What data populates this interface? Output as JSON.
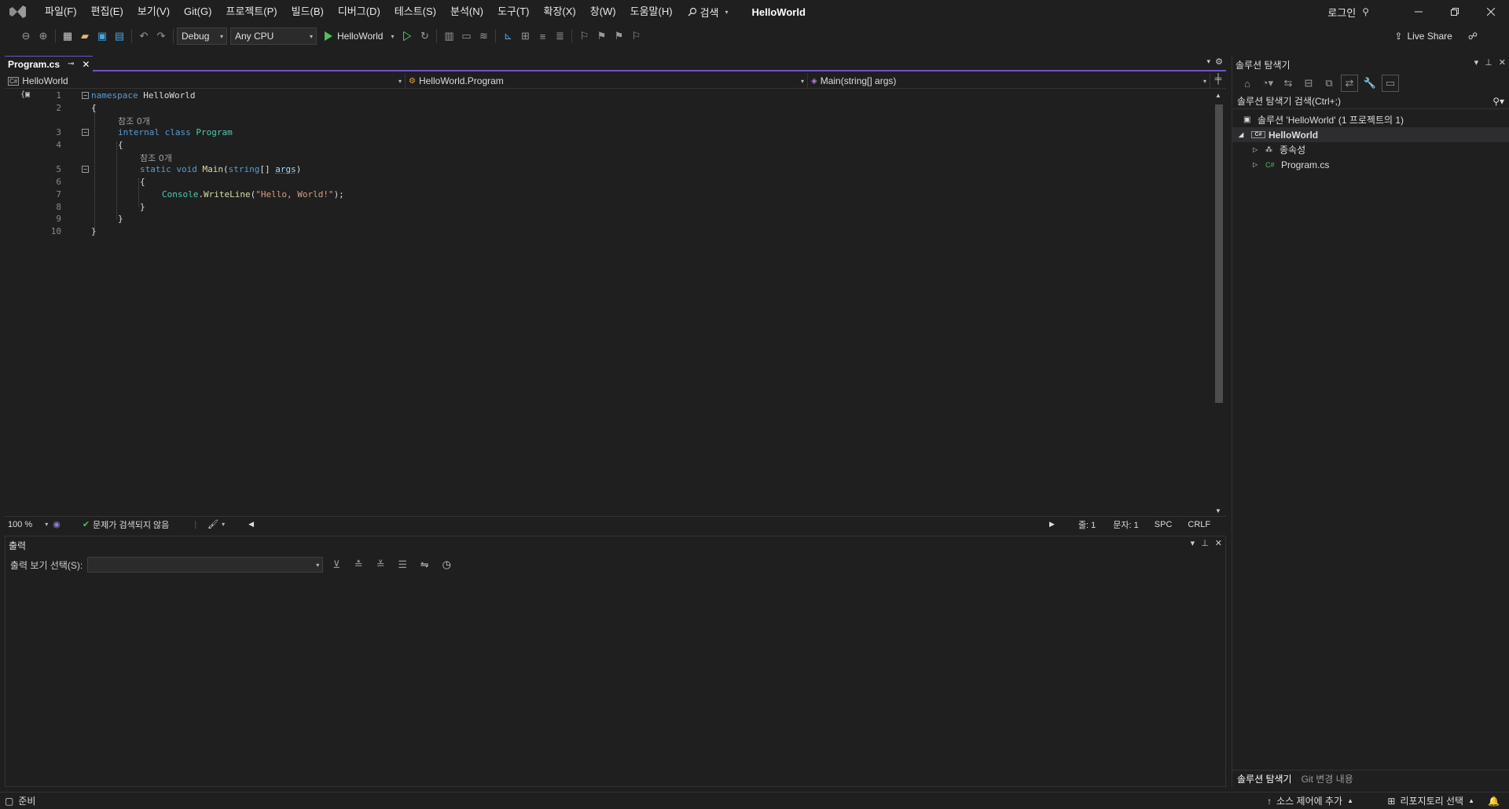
{
  "menu": {
    "items": [
      "파일(F)",
      "편집(E)",
      "보기(V)",
      "Git(G)",
      "프로젝트(P)",
      "빌드(B)",
      "디버그(D)",
      "테스트(S)",
      "분석(N)",
      "도구(T)",
      "확장(X)",
      "창(W)",
      "도움말(H)"
    ],
    "search_label": "검색",
    "solution_name": "HelloWorld",
    "login_label": "로그인"
  },
  "toolbar": {
    "config": "Debug",
    "platform": "Any CPU",
    "run_target": "HelloWorld",
    "live_share": "Live Share"
  },
  "editor": {
    "tab_label": "Program.cs",
    "nav_project": "HelloWorld",
    "nav_type": "HelloWorld.Program",
    "nav_member": "Main(string[] args)",
    "line_numbers": [
      "1",
      "2",
      "3",
      "4",
      "5",
      "6",
      "7",
      "8",
      "9",
      "10"
    ],
    "ref_count_1": "참조 0개",
    "ref_count_2": "참조 0개",
    "code": {
      "l1_kw": "namespace",
      "l1_name": " HelloWorld",
      "l2": "{",
      "l3_kw1": "internal",
      "l3_kw2": "class",
      "l3_type": "Program",
      "l4": "{",
      "l5_kw1": "static",
      "l5_kw2": "void",
      "l5_fn": "Main",
      "l5_p1": "(",
      "l5_kw3": "string",
      "l5_p2": "[] ",
      "l5_param": "args",
      "l5_p3": ")",
      "l6": "{",
      "l7_type": "Console",
      "l7_dot": ".",
      "l7_fn": "WriteLine",
      "l7_p1": "(",
      "l7_str": "\"Hello, World!\"",
      "l7_p2": ");",
      "l8": "}",
      "l9": "}",
      "l10": "}"
    },
    "status": {
      "zoom": "100 %",
      "issues": "문제가 검색되지 않음",
      "line": "줄: 1",
      "col": "문자: 1",
      "spc": "SPC",
      "crlf": "CRLF"
    }
  },
  "output": {
    "title": "출력",
    "select_label": "출력 보기 선택(S):"
  },
  "solution_explorer": {
    "title": "솔루션 탐색기",
    "search_placeholder": "솔루션 탐색기 검색(Ctrl+;)",
    "solution_node": "솔루션 'HelloWorld' (1 프로젝트의 1)",
    "project_node": "HelloWorld",
    "deps_node": "종속성",
    "file_node": "Program.cs",
    "cs_badge": "C#",
    "tab_explorer": "솔루션 탐색기",
    "tab_git": "Git 변경 내용"
  },
  "statusbar": {
    "ready": "준비",
    "add_source_control": "소스 제어에 추가",
    "select_repo": "리포지토리 선택"
  },
  "colors": {
    "accent": "#6f52c9",
    "background": "#1f1f1f",
    "keyword": "#569cd6",
    "type": "#4ec9b0",
    "string": "#d69d85"
  }
}
